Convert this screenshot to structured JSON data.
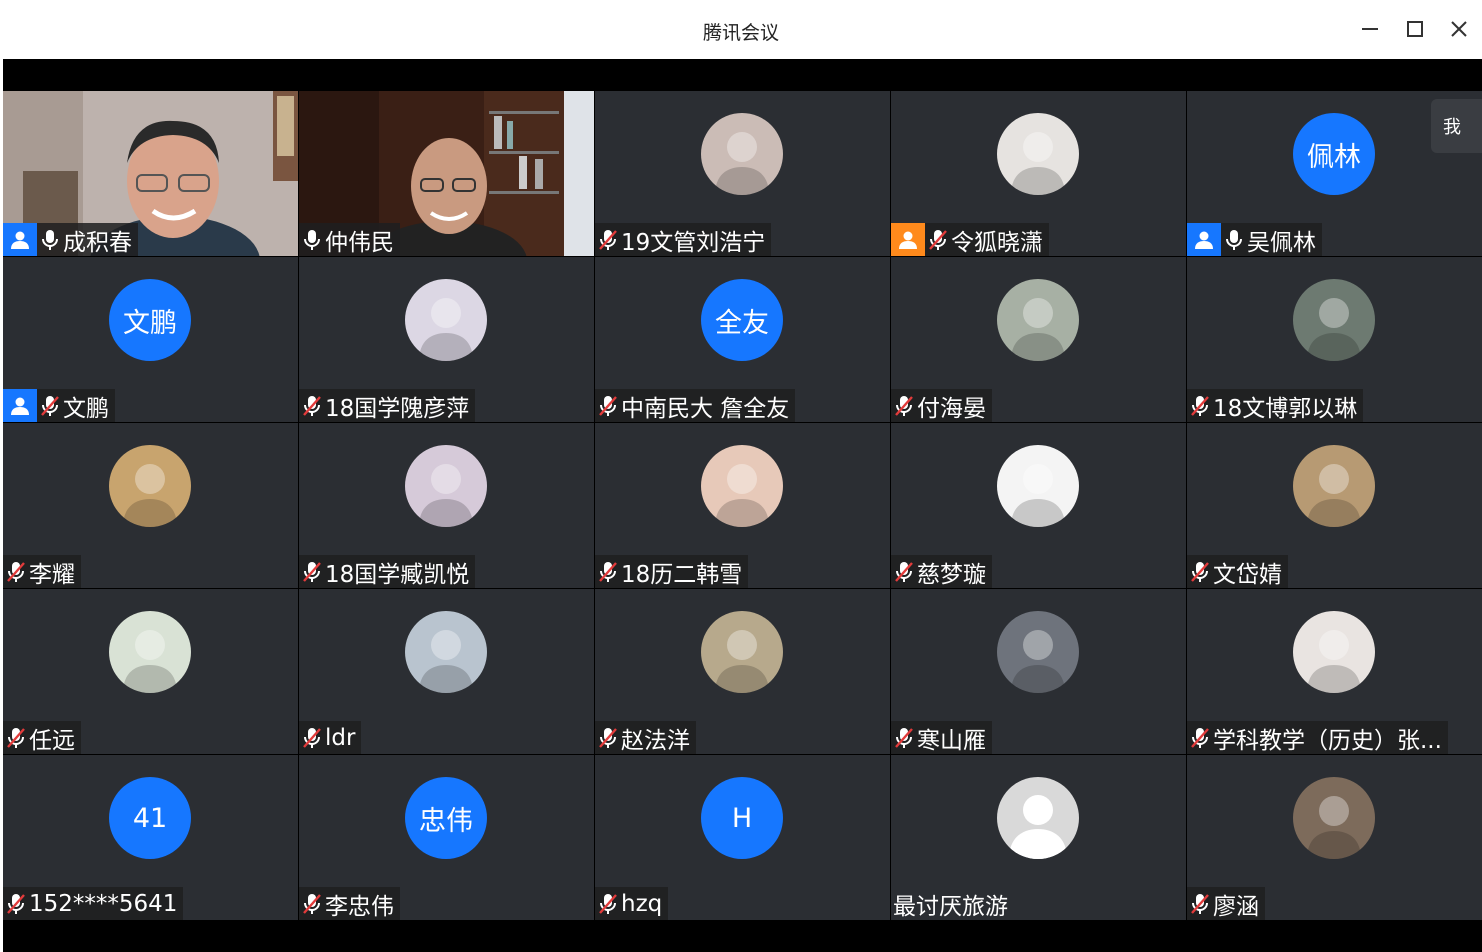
{
  "window": {
    "title": "腾讯会议"
  },
  "me_tag": "我",
  "participants": [
    {
      "name": "成积春",
      "mic": "on",
      "host": "blue",
      "kind": "video1",
      "active": true
    },
    {
      "name": "仲伟民",
      "mic": "on",
      "host": "",
      "kind": "video2"
    },
    {
      "name": "19文管刘浩宁",
      "mic": "off",
      "host": "",
      "kind": "photo",
      "color": "#cbbcb6",
      "icon": "dog-photo-icon"
    },
    {
      "name": "令狐晓潇",
      "mic": "off",
      "host": "orange",
      "kind": "photo",
      "color": "#e6e3e0",
      "icon": "anime-girl-photo-icon"
    },
    {
      "name": "吴佩林",
      "mic": "on",
      "host": "blue",
      "kind": "text",
      "avatar_text": "佩林"
    },
    {
      "name": "文鹏",
      "mic": "off",
      "host": "blue",
      "kind": "text",
      "avatar_text": "文鹏"
    },
    {
      "name": "18国学隗彦萍",
      "mic": "off",
      "host": "",
      "kind": "photo",
      "color": "#dcd7e4",
      "icon": "girl-hood-photo-icon"
    },
    {
      "name": "中南民大 詹全友",
      "mic": "off",
      "host": "",
      "kind": "text",
      "avatar_text": "全友"
    },
    {
      "name": "付海晏",
      "mic": "off",
      "host": "",
      "kind": "photo",
      "color": "#a7b0a4",
      "icon": "person-gate-photo-icon"
    },
    {
      "name": "18文博郭以琳",
      "mic": "off",
      "host": "",
      "kind": "photo",
      "color": "#6d7a71",
      "icon": "cartoon-photo-icon"
    },
    {
      "name": "李耀",
      "mic": "off",
      "host": "",
      "kind": "photo",
      "color": "#c8a46e",
      "icon": "shiba-photo-icon"
    },
    {
      "name": "18国学臧凯悦",
      "mic": "off",
      "host": "",
      "kind": "photo",
      "color": "#d6cad9",
      "icon": "tree-photo-icon"
    },
    {
      "name": "18历二韩雪",
      "mic": "off",
      "host": "",
      "kind": "photo",
      "color": "#e7c9b9",
      "icon": "baby-photo-icon"
    },
    {
      "name": "慈梦璇",
      "mic": "off",
      "host": "",
      "kind": "photo",
      "color": "#f4f4f4",
      "icon": "sticker-photo-icon"
    },
    {
      "name": "文岱婧",
      "mic": "off",
      "host": "",
      "kind": "photo",
      "color": "#b79a73",
      "icon": "ink-figure-photo-icon"
    },
    {
      "name": "任远",
      "mic": "off",
      "host": "",
      "kind": "photo",
      "color": "#d9e2d5",
      "icon": "boy-cartoon-photo-icon"
    },
    {
      "name": "ldr",
      "mic": "off",
      "host": "",
      "kind": "photo",
      "color": "#b9c4cf",
      "icon": "snow-warrior-photo-icon"
    },
    {
      "name": "赵法洋",
      "mic": "off",
      "host": "",
      "kind": "photo",
      "color": "#b7a98c",
      "icon": "horseman-photo-icon"
    },
    {
      "name": "寒山雁",
      "mic": "off",
      "host": "",
      "kind": "photo",
      "color": "#6e737c",
      "icon": "dancer-photo-icon"
    },
    {
      "name": "学科教学（历史）张...",
      "mic": "off",
      "host": "",
      "kind": "photo",
      "color": "#e9e4e1",
      "icon": "child-photo-icon"
    },
    {
      "name": "152****5641",
      "mic": "off",
      "host": "",
      "kind": "text",
      "avatar_text": "41"
    },
    {
      "name": "李忠伟",
      "mic": "off",
      "host": "",
      "kind": "text",
      "avatar_text": "忠伟"
    },
    {
      "name": "hzq",
      "mic": "off",
      "host": "",
      "kind": "text",
      "avatar_text": "H"
    },
    {
      "name": "最讨厌旅游",
      "mic": "none",
      "host": "",
      "kind": "gray"
    },
    {
      "name": "廖涵",
      "mic": "off",
      "host": "",
      "kind": "photo",
      "color": "#7d6b5b",
      "icon": "sunset-photo-icon"
    }
  ]
}
